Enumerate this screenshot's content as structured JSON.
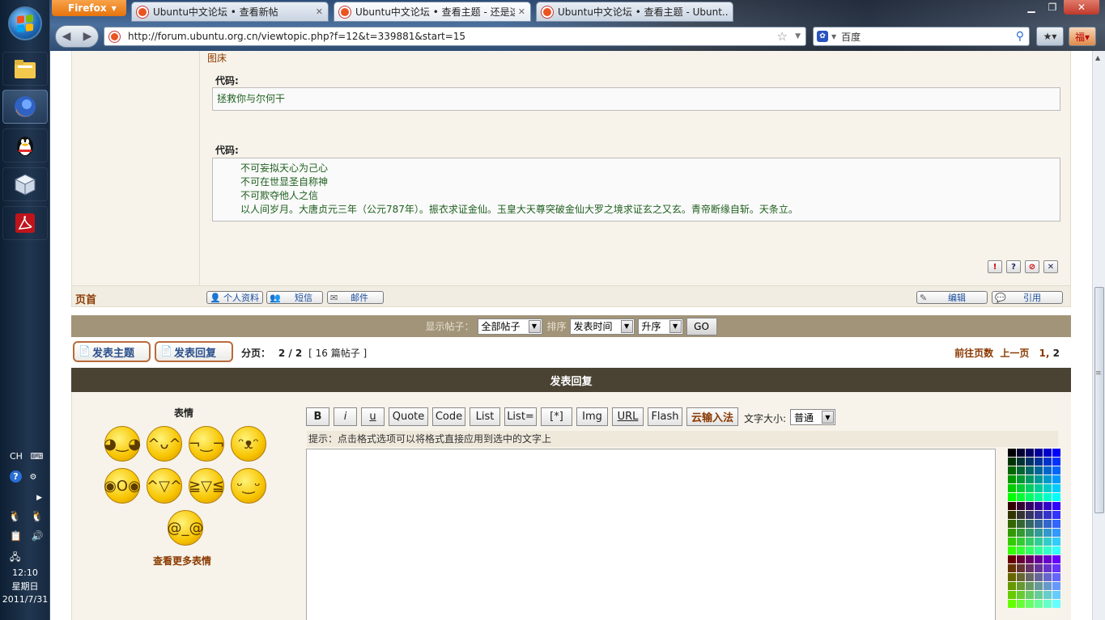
{
  "browser": {
    "menu_label": "Firefox",
    "tabs": [
      {
        "title": "Ubuntu中文论坛 • 查看新帖"
      },
      {
        "title": "Ubuntu中文论坛 • 查看主题 - 还是这..."
      },
      {
        "title": "Ubuntu中文论坛 • 查看主题 - Ubunt..."
      }
    ],
    "url": "http://forum.ubuntu.org.cn/viewtopic.php?f=12&t=339881&start=15",
    "search_placeholder": "百度"
  },
  "taskbar": {
    "lang": "CH",
    "time": "12:10",
    "weekday": "星期日",
    "date": "2011/7/31"
  },
  "post": {
    "top_link": "图床",
    "code_label_1": "代码:",
    "code_1": "拯救你与尔何干",
    "code_label_2": "代码:",
    "code_2_lines": [
      "不可妄拟天心为己心",
      "不可在世显圣自称神",
      "不可欺夺他人之信",
      "以人间岁月。大唐贞元三年（公元787年）。振衣求证金仙。玉皇大天尊突破金仙大罗之境求证玄之又玄。青帝断缘自斩。天条立。"
    ]
  },
  "profile_row": {
    "top": "页首",
    "profile": "个人资料",
    "pm": "短信",
    "email": "邮件",
    "edit": "编辑",
    "quote": "引用"
  },
  "sort_bar": {
    "show_label": "显示帖子：",
    "show_value": "全部帖子",
    "sort_label": "排序",
    "sort_value": "发表时间",
    "order_value": "升序",
    "go": "GO"
  },
  "pagination": {
    "new_topic": "发表主题",
    "reply": "发表回复",
    "page_label": "分页：",
    "page_value": "2 / 2",
    "post_count": "[ 16 篇帖子 ]",
    "goto": "前往页数",
    "prev": "上一页",
    "page_1": "1",
    "page_2": "2"
  },
  "reply": {
    "header": "发表回复",
    "smilies_title": "表情",
    "more_smilies": "查看更多表情",
    "buttons": {
      "bold": "B",
      "italic": "i",
      "underline": "u",
      "quote": "Quote",
      "code": "Code",
      "list": "List",
      "list_eq": "List=",
      "item": "[*]",
      "img": "Img",
      "url": "URL",
      "flash": "Flash",
      "cloud_ime": "云输入法"
    },
    "font_size_label": "文字大小:",
    "font_size_value": "普通",
    "hint": "提示：点击格式选项可以将格式直接应用到选中的文字上"
  },
  "colors": {
    "post_bg": "#f7f3ea",
    "sort_bar_bg": "#a19479",
    "reply_header_bg": "#4a4334",
    "link_brown": "#8a3a00",
    "code_green": "#206020"
  }
}
